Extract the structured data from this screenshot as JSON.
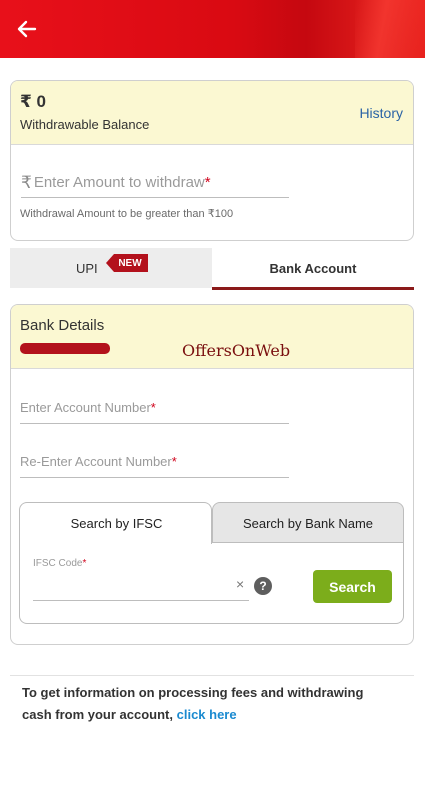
{
  "colors": {
    "header": "#e8101a",
    "card_highlight": "#fbf8d2",
    "link": "#2a63a5",
    "search_button": "#7cad1b",
    "tab_underline": "#8b1a1a",
    "new_badge": "#b3111c"
  },
  "header": {
    "back_icon": "arrow-left-icon"
  },
  "balance": {
    "amount": "₹ 0",
    "label": "Withdrawable Balance",
    "history_link": "History",
    "amount_field": {
      "currency_symbol": "₹",
      "placeholder": "Enter Amount to withdraw",
      "required_mark": "*"
    },
    "hint": "Withdrawal Amount to be greater than ₹100"
  },
  "method_tabs": [
    {
      "label": "UPI",
      "badge": "NEW",
      "selected": false
    },
    {
      "label": "Bank Account",
      "selected": true
    }
  ],
  "bank_details": {
    "title": "Bank Details",
    "watermark": "OffersOnWeb",
    "account_number": {
      "placeholder": "Enter Account Number",
      "required_mark": "*"
    },
    "reenter_account_number": {
      "placeholder": "Re-Enter Account Number",
      "required_mark": "*"
    },
    "ifsc_tabs": [
      {
        "label": "Search by IFSC",
        "selected": true
      },
      {
        "label": "Search by Bank Name",
        "selected": false
      }
    ],
    "ifsc_field": {
      "label": "IFSC Code",
      "required_mark": "*",
      "value": ""
    },
    "clear_icon": "×",
    "help_icon": "?",
    "search_button": "Search"
  },
  "info": {
    "text": "To get information on processing fees and withdrawing cash from your account,",
    "link": "click here"
  }
}
